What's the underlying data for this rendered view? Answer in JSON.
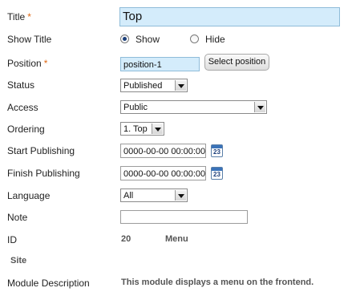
{
  "fields": {
    "title": {
      "label": "Title",
      "required_mark": "*",
      "value": "Top"
    },
    "show_title": {
      "label": "Show Title",
      "options": [
        "Show",
        "Hide"
      ],
      "selected": "Show"
    },
    "position": {
      "label": "Position",
      "required_mark": "*",
      "value": "position-1",
      "button": "Select position"
    },
    "status": {
      "label": "Status",
      "value": "Published"
    },
    "access": {
      "label": "Access",
      "value": "Public"
    },
    "ordering": {
      "label": "Ordering",
      "value": "1. Top"
    },
    "start_publishing": {
      "label": "Start Publishing",
      "value": "0000-00-00 00:00:00",
      "calendar_day": "23"
    },
    "finish_publishing": {
      "label": "Finish Publishing",
      "value": "0000-00-00 00:00:00",
      "calendar_day": "23"
    },
    "language": {
      "label": "Language",
      "value": "All"
    },
    "note": {
      "label": "Note",
      "value": ""
    },
    "id": {
      "label": "ID",
      "value": "20",
      "type": "Menu"
    },
    "site": {
      "label": "Site"
    },
    "module_description": {
      "label": "Module Description",
      "value": "This module displays a menu on the frontend."
    }
  },
  "icons": {
    "calendar": "calendar-icon",
    "dropdown": "chevron-down-icon"
  },
  "colors": {
    "required": "#e06a16",
    "highlight_field": "#d4ecfb"
  }
}
